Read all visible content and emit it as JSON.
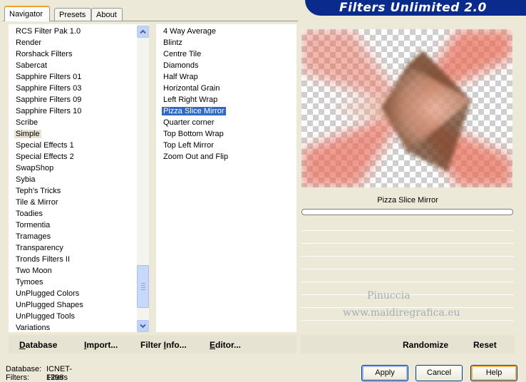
{
  "tabs": [
    "Navigator",
    "Presets",
    "About"
  ],
  "brand_title": "Filters Unlimited 2.0",
  "categories": [
    "RCS Filter Pak 1.0",
    "Render",
    "Rorshack Filters",
    "Sabercat",
    "Sapphire Filters 01",
    "Sapphire Filters 03",
    "Sapphire Filters 09",
    "Sapphire Filters 10",
    "Scribe",
    "Simple",
    "Special Effects 1",
    "Special Effects 2",
    "SwapShop",
    "Sybia",
    "Teph's Tricks",
    "Tile & Mirror",
    "Toadies",
    "Tormentia",
    "Tramages",
    "Transparency",
    "Tronds Filters II",
    "Two Moon",
    "Tymoes",
    "UnPlugged Colors",
    "UnPlugged Shapes",
    "UnPlugged Tools",
    "Variations"
  ],
  "selected_category": "Simple",
  "filters": [
    "4 Way Average",
    "Blintz",
    "Centre Tile",
    "Diamonds",
    "Half Wrap",
    "Horizontal Grain",
    "Left Right Wrap",
    "Pizza Slice Mirror",
    "Quarter corner",
    "Top Bottom Wrap",
    "Top Left Mirror",
    "Zoom Out and Flip"
  ],
  "selected_filter": "Pizza Slice Mirror",
  "preview_filter_name": "Pizza Slice Mirror",
  "progress": 0,
  "watermark": {
    "line1": "Pinuccia",
    "line2": "www.maidiregrafica.eu"
  },
  "toolbar_left": [
    {
      "label": "Database",
      "accel": "D",
      "rest": "atabase"
    },
    {
      "label": "Import...",
      "accel": "I",
      "rest": "mport..."
    },
    {
      "label": "Filter Info...",
      "accel": "",
      "rest": "Filter ",
      "accel2": "I",
      "rest2": "nfo..."
    },
    {
      "label": "Editor...",
      "accel": "E",
      "rest": "ditor..."
    }
  ],
  "toolbar_right": [
    "Randomize",
    "Reset"
  ],
  "status": {
    "database_label": "Database:",
    "database_value": "ICNET-Filters",
    "filters_label": "Filters:",
    "filters_value": "1298"
  },
  "dialog_buttons": [
    "Apply",
    "Cancel",
    "Help"
  ],
  "colors": {
    "selection": "#316ac5",
    "brand": "#0a2a8c",
    "preview_accent": "#e96a55",
    "preview_center": "#7a4a30"
  },
  "icons": {
    "scroll_up": "chevron-up-icon",
    "scroll_down": "chevron-down-icon"
  }
}
